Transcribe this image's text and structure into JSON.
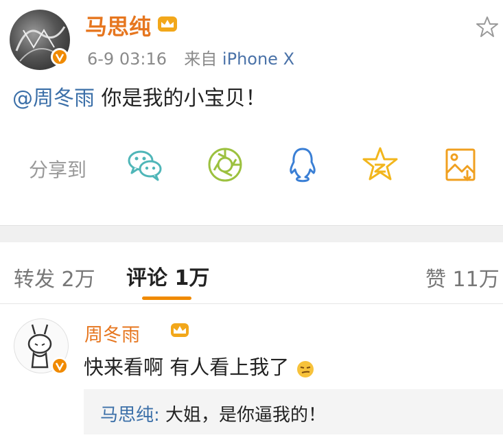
{
  "post": {
    "author": "马思纯",
    "time": "6-9 03:16",
    "source_prefix": "来自",
    "source_device": "iPhone X",
    "mention": "@周冬雨",
    "text": " 你是我的小宝贝！"
  },
  "share": {
    "label": "分享到",
    "targets": [
      "wechat-icon",
      "moments-icon",
      "qq-icon",
      "qzone-icon",
      "save-image-icon"
    ]
  },
  "tabs": {
    "repost_label": "转发",
    "repost_count": "2万",
    "comment_label": "评论",
    "comment_count": "1万",
    "like_label": "赞",
    "like_count": "11万"
  },
  "comment": {
    "author": "周冬雨",
    "text": "快来看啊 有人看上我了",
    "reply_author": "马思纯:",
    "reply_text": " 大姐，是你逼我的！"
  },
  "colors": {
    "accent": "#f08a00",
    "name": "#e6761f",
    "mention": "#3b6fa8",
    "wechat": "#4fb6b8",
    "moments": "#9cc13f",
    "qq": "#3a7fd5",
    "qzone": "#f2b61c",
    "save": "#f0a020"
  }
}
